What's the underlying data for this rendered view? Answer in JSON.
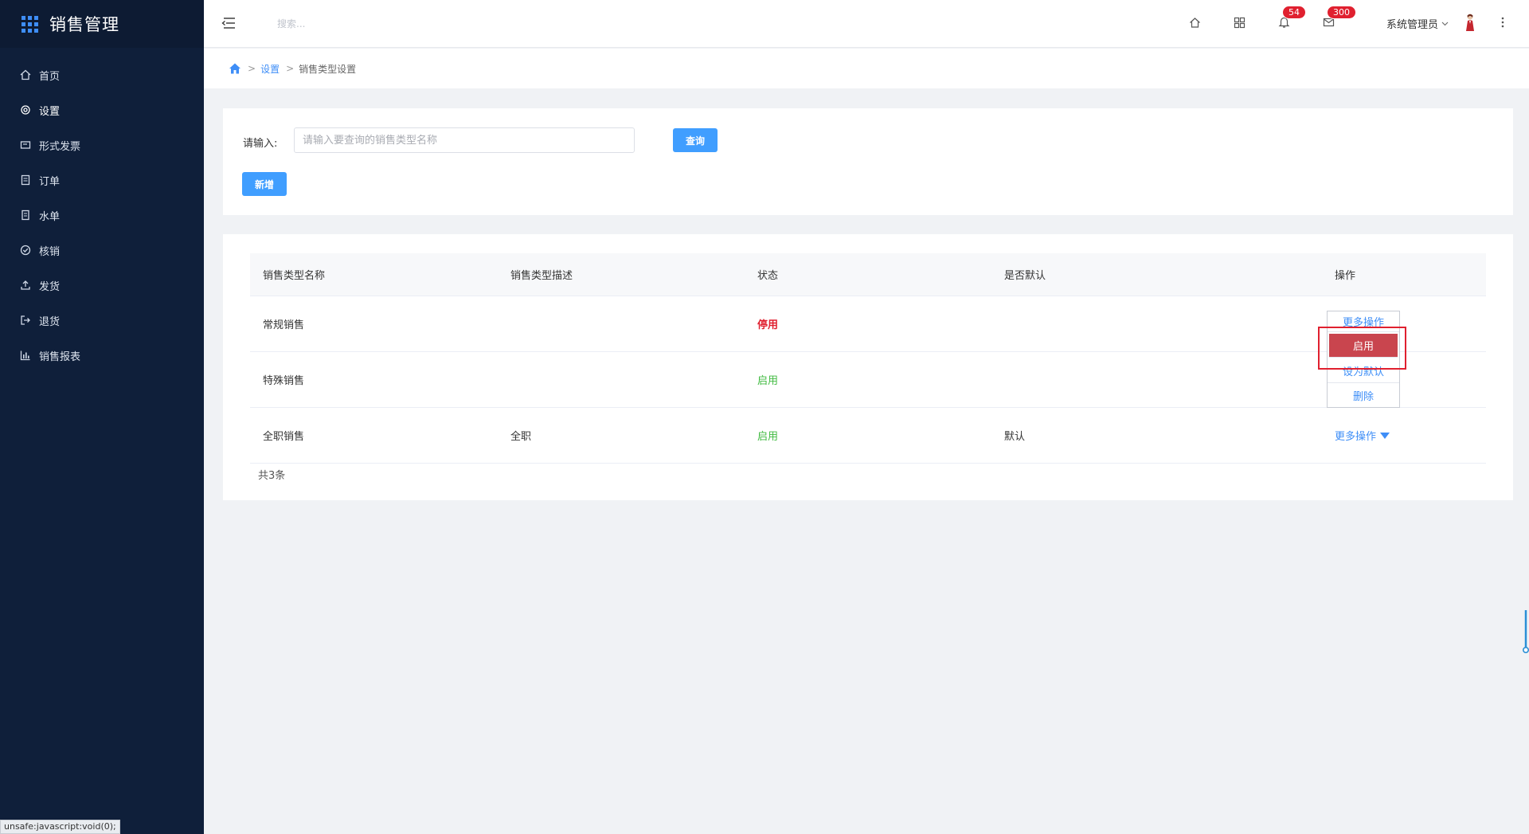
{
  "app": {
    "title": "销售管理"
  },
  "sidebar": {
    "items": [
      {
        "label": "首页",
        "icon": "home-icon"
      },
      {
        "label": "设置",
        "icon": "gear-icon"
      },
      {
        "label": "形式发票",
        "icon": "invoice-icon"
      },
      {
        "label": "订单",
        "icon": "order-icon"
      },
      {
        "label": "水单",
        "icon": "receipt-icon"
      },
      {
        "label": "核销",
        "icon": "check-circle-icon"
      },
      {
        "label": "发货",
        "icon": "upload-icon"
      },
      {
        "label": "退货",
        "icon": "return-icon"
      },
      {
        "label": "销售报表",
        "icon": "bar-chart-icon"
      }
    ],
    "status_tip": "unsafe:javascript:void(0);"
  },
  "header": {
    "search_placeholder": "搜索...",
    "notifications_badge": "54",
    "messages_badge": "300",
    "user_name": "系统管理员"
  },
  "breadcrumb": {
    "sep": ">",
    "parent": "设置",
    "current": "销售类型设置"
  },
  "query": {
    "label": "请输入:",
    "input_placeholder": "请输入要查询的销售类型名称",
    "input_value": "",
    "query_button": "查询",
    "add_button": "新增"
  },
  "table": {
    "columns": [
      "销售类型名称",
      "销售类型描述",
      "状态",
      "是否默认",
      "操作"
    ],
    "rows": [
      {
        "name": "常规销售",
        "desc": "",
        "status": "停用",
        "default": "",
        "action": "更多操作"
      },
      {
        "name": "特殊销售",
        "desc": "",
        "status": "启用",
        "default": "",
        "action": ""
      },
      {
        "name": "全职销售",
        "desc": "全职",
        "status": "启用",
        "default": "默认",
        "action": "更多操作"
      }
    ],
    "total": "共3条"
  },
  "dropdown": {
    "trigger": "更多操作",
    "items": [
      "启用",
      "设为默认",
      "删除"
    ]
  },
  "colors": {
    "sidebar_bg": "#0f1f3a",
    "accent": "#409eff",
    "status_off": "#e0202f",
    "status_on": "#3fba3f",
    "highlight": "#c9454e"
  }
}
